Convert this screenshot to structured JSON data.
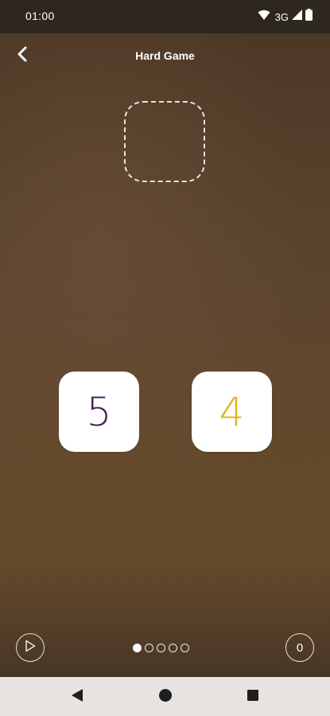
{
  "status_bar": {
    "time": "01:00",
    "network": "3G",
    "icons": [
      "wifi-icon",
      "signal-icon",
      "battery-icon"
    ]
  },
  "header": {
    "title": "Hard Game",
    "back_icon": "chevron-left-icon"
  },
  "game": {
    "target_slot": "empty",
    "tiles": [
      {
        "value": "5",
        "color": "#4d1f5c"
      },
      {
        "value": "4",
        "color": "#e3b21e"
      }
    ]
  },
  "footer": {
    "play_icon": "play-icon",
    "pages": {
      "total": 5,
      "current": 1
    },
    "score": "0"
  },
  "nav_bar": {
    "icons": [
      "back-triangle-icon",
      "home-circle-icon",
      "recents-square-icon"
    ]
  }
}
